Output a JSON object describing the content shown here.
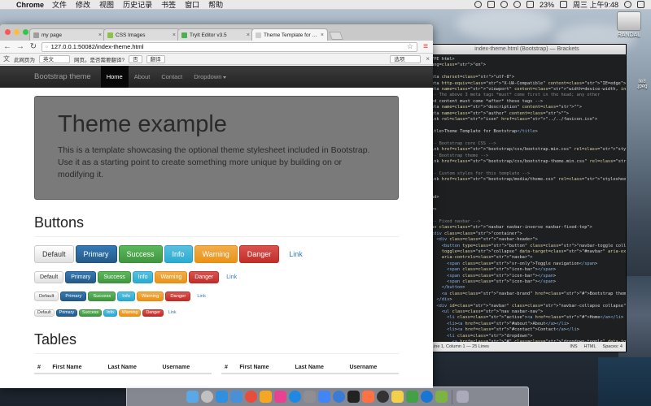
{
  "menubar": {
    "app": "Chrome",
    "items": [
      "文件",
      "修改",
      "视图",
      "历史记录",
      "书签",
      "窗口",
      "帮助"
    ],
    "battery": "23%",
    "clock": "周三 上午9:48"
  },
  "desktop": {
    "drive_label": "RANDAL",
    "side_file": "ile8 .jpeg"
  },
  "brackets": {
    "title": "index-theme.html (Bootstrap) — Brackets",
    "status": {
      "left": "Line 1, Column 1 — 25 Lines",
      "ins": "INS",
      "mode": "HTML",
      "spaces": "Spaces: 4"
    },
    "lines": [
      {
        "t": "YPE html>"
      },
      {
        "t": "ang=\"en\">"
      },
      {
        "t": ""
      },
      {
        "t": "eta charset=\"utf-8\">"
      },
      {
        "t": "eta http-equiv=\"X-UA-Compatible\" content=\"IE=edge\">"
      },
      {
        "t": "eta name=\"viewport\" content=\"width=device-width, initial-scale=1\">"
      },
      {
        "t": "-- The above 3 meta tags *must* come first in the head; any other"
      },
      {
        "t": "ed content must come *after* these tags -->"
      },
      {
        "t": "eta name=\"description\" content=\"\">"
      },
      {
        "t": "eta name=\"author\" content=\"\">"
      },
      {
        "t": "ink rel=\"icon\" href=\"../../favicon.ico\">"
      },
      {
        "t": ""
      },
      {
        "t": "itle>Theme Template for Bootstrap</title>"
      },
      {
        "t": ""
      },
      {
        "t": "-- Bootstrap core CSS -->"
      },
      {
        "t": "ink href=\"bootstrap/css/bootstrap.min.css\" rel=\"stylesheet\">"
      },
      {
        "t": "-- Bootstrap theme -->"
      },
      {
        "t": "ink href=\"bootstrap/css/bootstrap-theme.min.css\" rel=\"stylesheet\">"
      },
      {
        "t": ""
      },
      {
        "t": "-- Custom styles for this template -->"
      },
      {
        "t": "ink href=\"bootstrap/media/theme.css\" rel=\"stylesheet\">"
      },
      {
        "t": ""
      },
      {
        "t": ""
      },
      {
        "t": "ad>"
      },
      {
        "t": ""
      },
      {
        "t": "y>"
      },
      {
        "t": ""
      },
      {
        "t": "-- Fixed navbar -->"
      },
      {
        "t": "av class=\"navbar navbar-inverse navbar-fixed-top\">"
      },
      {
        "t": "<div class=\"container\">"
      },
      {
        "t": "  <div class=\"navbar-header\">"
      },
      {
        "t": "    <button type=\"button\" class=\"navbar-toggle collapsed\" data-"
      },
      {
        "t": "    toggle=\"collapse\" data-target=\"#navbar\" aria-expanded=\"false\""
      },
      {
        "t": "    aria-controls=\"navbar\">"
      },
      {
        "t": "      <span class=\"sr-only\">Toggle navigation</span>"
      },
      {
        "t": "      <span class=\"icon-bar\"></span>"
      },
      {
        "t": "      <span class=\"icon-bar\"></span>"
      },
      {
        "t": "      <span class=\"icon-bar\"></span>"
      },
      {
        "t": "    </button>"
      },
      {
        "t": "    <a class=\"navbar-brand\" href=\"#\">Bootstrap theme</a>"
      },
      {
        "t": "  </div>"
      },
      {
        "t": "  <div id=\"navbar\" class=\"navbar-collapse collapse\">"
      },
      {
        "t": "    <ul class=\"nav navbar-nav\">"
      },
      {
        "t": "      <li class=\"active\"><a href=\"#\">Home</a></li>"
      },
      {
        "t": "      <li><a href=\"#about\">About</a></li>"
      },
      {
        "t": "      <li><a href=\"#contact\">Contact</a></li>"
      },
      {
        "t": "      <li class=\"dropdown\">"
      },
      {
        "t": "        <a href=\"#\" class=\"dropdown-toggle\" data-toggle=\"dropdown\""
      },
      {
        "t": "        role=\"button\" aria-haspopup=\"true\" aria-"
      }
    ]
  },
  "chrome": {
    "tabs": [
      {
        "title": "my page",
        "favicon_color": "#9e9e9e"
      },
      {
        "title": "CSS Images",
        "favicon_color": "#8bc34a"
      },
      {
        "title": "TryIt Editor v3.5",
        "favicon_color": "#4caf50"
      },
      {
        "title": "Theme Template for Bootstr",
        "favicon_color": "#cfcfcf"
      }
    ],
    "url": "127.0.0.1:50082/index-theme.html",
    "translate": {
      "label": "此网页为",
      "language": "英文",
      "question": "网页。是否需要翻译?",
      "no": "否",
      "translate": "翻译",
      "options": "选项"
    }
  },
  "page": {
    "navbar": {
      "brand": "Bootstrap theme",
      "items": [
        {
          "label": "Home",
          "active": true
        },
        {
          "label": "About",
          "active": false
        },
        {
          "label": "Contact",
          "active": false
        },
        {
          "label": "Dropdown",
          "active": false
        }
      ]
    },
    "jumbotron": {
      "title": "Theme example",
      "text": "This is a template showcasing the optional theme stylesheet included in Bootstrap. Use it as a starting point to create something more unique by building on or modifying it."
    },
    "buttons_heading": "Buttons",
    "button_labels": [
      "Default",
      "Primary",
      "Success",
      "Info",
      "Warning",
      "Danger",
      "Link"
    ],
    "tables_heading": "Tables",
    "table_headers": [
      "#",
      "First Name",
      "Last Name",
      "Username"
    ]
  },
  "colors": {
    "primary": "#337ab7",
    "success": "#5cb85c",
    "info": "#5bc0de",
    "warning": "#f0ad4e",
    "danger": "#d9534f",
    "navbar": "#222222"
  },
  "dock": {
    "icons": [
      "finder-icon",
      "launchpad-icon",
      "safari-icon",
      "mail-icon",
      "calendar-icon",
      "photos-icon",
      "itunes-icon",
      "app-store-icon",
      "preferences-icon",
      "chrome-icon",
      "brackets-icon",
      "qq-icon",
      "firefox-icon",
      "terminal-icon",
      "notes-icon",
      "maps-icon",
      "kugou-icon",
      "iqiyi-icon",
      "trash-icon"
    ]
  }
}
